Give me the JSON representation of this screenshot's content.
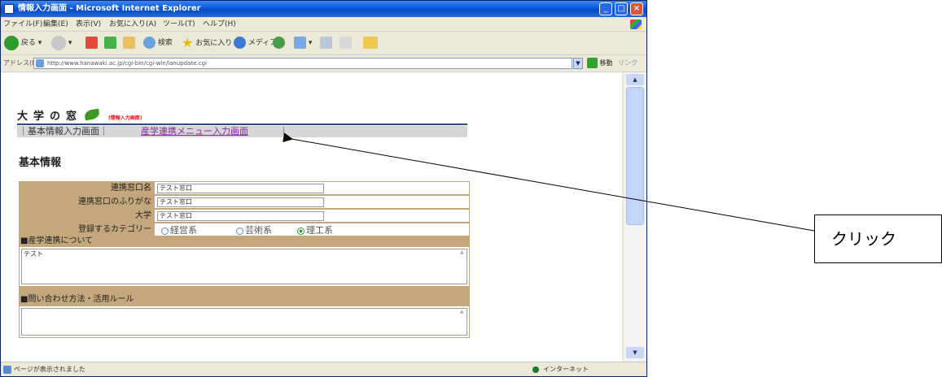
{
  "window": {
    "title": "情報入力画面 - Microsoft Internet Explorer",
    "min_label": "_",
    "max_label": "□",
    "close_label": "×"
  },
  "menubar": {
    "items": [
      "ファイル(F)",
      "編集(E)",
      "表示(V)",
      "お気に入り(A)",
      "ツール(T)",
      "ヘルプ(H)"
    ]
  },
  "toolbar": {
    "back_label": "戻る",
    "search_label": "検索",
    "favorites_label": "お気に入り",
    "media_label": "メディア"
  },
  "address": {
    "label": "アドレス(D)",
    "url": "http://www.hanawaki.ac.jp/cgi-bin/cgi-win/lanupdate.cgi",
    "go_label": "移動",
    "links_label": "リンク"
  },
  "page": {
    "logo_text": "大学の窓",
    "logo_sub": "(情報入力画面)",
    "nav_basic": "｜基本情報入力画面｜",
    "nav_link": "産学連携メニュー入力画面",
    "nav_end": "｜",
    "section_title": "基本情報",
    "fields": [
      {
        "label": "連携窓口名",
        "value": "テスト窓口"
      },
      {
        "label": "連携窓口のふりがな",
        "value": "テスト窓口"
      },
      {
        "label": "大学",
        "value": "テスト窓口"
      }
    ],
    "category": {
      "label": "登録するカテゴリー",
      "options": [
        "経営系",
        "芸術系",
        "理工系"
      ],
      "selected_index": 2
    },
    "block1": {
      "heading": "■産学連携について",
      "value": "テスト"
    },
    "block2": {
      "heading": "■問い合わせ方法・活用ルール",
      "value": ""
    }
  },
  "statusbar": {
    "text": "ページが表示されました",
    "zone": "インターネット"
  },
  "callout": {
    "text": "クリック"
  }
}
